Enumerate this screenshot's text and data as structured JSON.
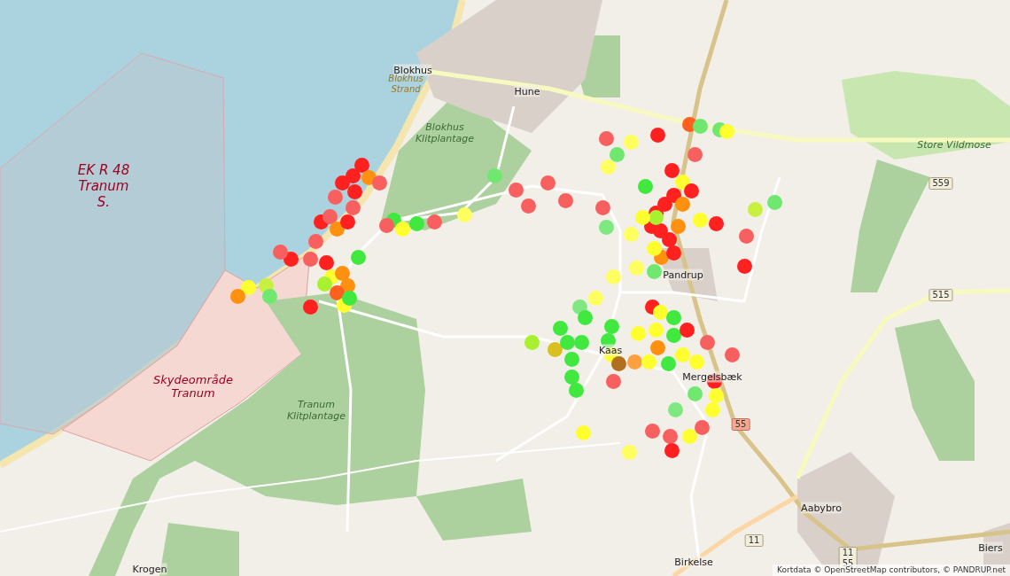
{
  "map": {
    "labels": [
      {
        "text": "EK R 48 Tranum S.",
        "kind": "military"
      },
      {
        "text": "Blokhus",
        "kind": "town"
      },
      {
        "text": "Blokhus Strand",
        "kind": "beach"
      },
      {
        "text": "Hune",
        "kind": "town"
      },
      {
        "text": "Blokhus Klitplantage",
        "kind": "forest"
      },
      {
        "text": "Store Vildmose",
        "kind": "forest"
      },
      {
        "text": "Pandrup",
        "kind": "town"
      },
      {
        "text": "Kaas",
        "kind": "town"
      },
      {
        "text": "Mergelsbæk",
        "kind": "town"
      },
      {
        "text": "Skydeområde Tranum",
        "kind": "military"
      },
      {
        "text": "Tranum Klitplantage",
        "kind": "forest"
      },
      {
        "text": "Aabybro",
        "kind": "town"
      },
      {
        "text": "Birkelse",
        "kind": "town"
      },
      {
        "text": "Krogen",
        "kind": "town"
      },
      {
        "text": "Biers",
        "kind": "town"
      }
    ],
    "shields": [
      {
        "text": "559"
      },
      {
        "text": "515"
      },
      {
        "text": "55",
        "kind": "red"
      },
      {
        "text": "11"
      },
      {
        "text": "11 55"
      }
    ],
    "markers": [
      {
        "color": "#ff2020"
      },
      {
        "color": "#ff2020"
      },
      {
        "color": "#ff2020"
      },
      {
        "color": "#ff9010"
      },
      {
        "color": "#f86060"
      },
      {
        "color": "#ff2020"
      },
      {
        "color": "#f86060"
      },
      {
        "color": "#f86060"
      },
      {
        "color": "#ff2020"
      },
      {
        "color": "#f86060"
      },
      {
        "color": "#ff9010"
      },
      {
        "color": "#ff2020"
      },
      {
        "color": "#f86060"
      },
      {
        "color": "#f86060"
      },
      {
        "color": "#ff2020"
      },
      {
        "color": "#f86060"
      },
      {
        "color": "#ff2020"
      },
      {
        "color": "#ffff30"
      },
      {
        "color": "#ff9010"
      },
      {
        "color": "#a8f030"
      },
      {
        "color": "#ff9010"
      },
      {
        "color": "#40e840"
      },
      {
        "color": "#ff6020"
      },
      {
        "color": "#ffff30"
      },
      {
        "color": "#40e840"
      },
      {
        "color": "#ff2020"
      },
      {
        "color": "#c8f040"
      },
      {
        "color": "#ffff30"
      },
      {
        "color": "#ff9010"
      },
      {
        "color": "#70e870"
      },
      {
        "color": "#40e840"
      },
      {
        "color": "#ffff30"
      },
      {
        "color": "#40e840"
      },
      {
        "color": "#f86060"
      },
      {
        "color": "#f86060"
      },
      {
        "color": "#ffff60"
      },
      {
        "color": "#70e870"
      },
      {
        "color": "#f86060"
      },
      {
        "color": "#f86060"
      },
      {
        "color": "#f86060"
      },
      {
        "color": "#f86060"
      },
      {
        "color": "#f86060"
      },
      {
        "color": "#ffff60"
      },
      {
        "color": "#70e870"
      },
      {
        "color": "#ffff60"
      },
      {
        "color": "#ff2020"
      },
      {
        "color": "#ff6020"
      },
      {
        "color": "#70e870"
      },
      {
        "color": "#70e870"
      },
      {
        "color": "#ffff30"
      },
      {
        "color": "#f86060"
      },
      {
        "color": "#80e880"
      },
      {
        "color": "#ffff60"
      },
      {
        "color": "#40e840"
      },
      {
        "color": "#ff2020"
      },
      {
        "color": "#ff2020"
      },
      {
        "color": "#ff2020"
      },
      {
        "color": "#ff9010"
      },
      {
        "color": "#ff2020"
      },
      {
        "color": "#ff2020"
      },
      {
        "color": "#ff2020"
      },
      {
        "color": "#ff9010"
      },
      {
        "color": "#a8f030"
      },
      {
        "color": "#ffff30"
      },
      {
        "color": "#ff2020"
      },
      {
        "color": "#f86060"
      },
      {
        "color": "#ffff30"
      },
      {
        "color": "#ff2020"
      },
      {
        "color": "#ffff30"
      },
      {
        "color": "#ff2020"
      },
      {
        "color": "#f86060"
      },
      {
        "color": "#c8f040"
      },
      {
        "color": "#70e870"
      },
      {
        "color": "#ff2020"
      },
      {
        "color": "#ff9010"
      },
      {
        "color": "#ffff30"
      },
      {
        "color": "#ff2020"
      },
      {
        "color": "#ffff60"
      },
      {
        "color": "#ffff60"
      },
      {
        "color": "#70e870"
      },
      {
        "color": "#ffff60"
      },
      {
        "color": "#80e880"
      },
      {
        "color": "#40e840"
      },
      {
        "color": "#a8f030"
      },
      {
        "color": "#d8c020"
      },
      {
        "color": "#40e840"
      },
      {
        "color": "#40e840"
      },
      {
        "color": "#40e840"
      },
      {
        "color": "#40e840"
      },
      {
        "color": "#40e840"
      },
      {
        "color": "#40e840"
      },
      {
        "color": "#40e840"
      },
      {
        "color": "#40e840"
      },
      {
        "color": "#ffff30"
      },
      {
        "color": "#b07020"
      },
      {
        "color": "#ffa040"
      },
      {
        "color": "#f86060"
      },
      {
        "color": "#ffff30"
      },
      {
        "color": "#ff2020"
      },
      {
        "color": "#ffff30"
      },
      {
        "color": "#40e840"
      },
      {
        "color": "#ffff30"
      },
      {
        "color": "#40e840"
      },
      {
        "color": "#ff2020"
      },
      {
        "color": "#ffff30"
      },
      {
        "color": "#40e840"
      },
      {
        "color": "#ffff30"
      },
      {
        "color": "#ffff30"
      },
      {
        "color": "#ff9010"
      },
      {
        "color": "#f86060"
      },
      {
        "color": "#f86060"
      },
      {
        "color": "#ff2020"
      },
      {
        "color": "#70e870"
      },
      {
        "color": "#ffff30"
      },
      {
        "color": "#ffff30"
      },
      {
        "color": "#ffff60"
      },
      {
        "color": "#f86060"
      },
      {
        "color": "#f86060"
      },
      {
        "color": "#ff2020"
      },
      {
        "color": "#ffff30"
      },
      {
        "color": "#f86060"
      },
      {
        "color": "#80e880"
      },
      {
        "color": "#ffff30"
      }
    ]
  },
  "attribution": "Kortdata © OpenStreetMap contributors, © PANDRUP.net"
}
